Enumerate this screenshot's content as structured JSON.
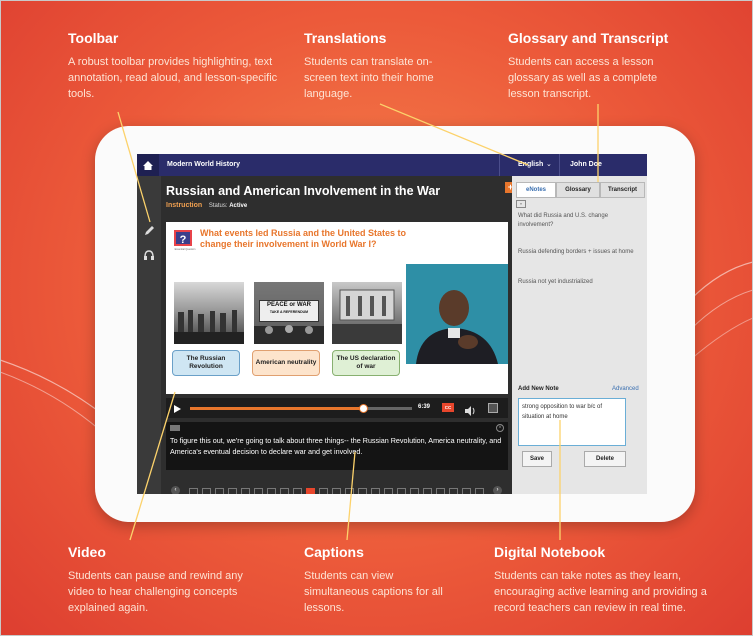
{
  "callouts": {
    "toolbar": {
      "title": "Toolbar",
      "text": "A robust toolbar provides highlighting, text annotation, read aloud, and lesson-specific tools."
    },
    "translations": {
      "title": "Translations",
      "text": "Students can translate on-screen text into their home language."
    },
    "glossary": {
      "title": "Glossary and Transcript",
      "text": "Students can access a lesson glossary as well as a complete lesson transcript."
    },
    "video": {
      "title": "Video",
      "text": "Students can pause and rewind any video to hear challenging concepts explained again."
    },
    "captions": {
      "title": "Captions",
      "text": "Students can view simultaneous captions for all lessons."
    },
    "notebook": {
      "title": "Digital Notebook",
      "text": "Students can take notes as they learn, encouraging active learning and providing a record teachers can review in real time."
    }
  },
  "app": {
    "course_title": "Modern World History",
    "language": "English",
    "user": "John Doe",
    "lesson_title": "Russian and American Involvement in the War",
    "section": "Instruction",
    "status_label": "Status:",
    "status_value": "Active",
    "question": "What events led Russia and the United States to change their involvement in World War I?",
    "question_badge": "Essential Question",
    "images": [
      {
        "sign_line1": "PEACE or WAR",
        "sign_line2": "TAKE A REFERENDUM"
      }
    ],
    "captions": [
      "The Russian Revolution",
      "American neutrality",
      "The US declaration of war"
    ],
    "caption_colors": [
      "#cfe6f3",
      "#fde4cc",
      "#dff0d5"
    ],
    "video_time": "6:39",
    "cc_label": "CC",
    "caption_text": "To figure this out, we're going to talk about three things-- the Russian Revolution, America neutrality, and America's eventual decision to declare war and get involved.",
    "video_progress": 0.78
  },
  "panel": {
    "tabs": [
      "eNotes",
      "Glossary",
      "Transcript"
    ],
    "notes": [
      "What did Russia and U.S. change involvement?",
      "Russia defending borders + issues at home",
      "Russia not yet industrialized"
    ],
    "add_note_label": "Add New Note",
    "advanced_label": "Advanced",
    "note_input": "strong opposition to war b/c of situation at home",
    "save_label": "Save",
    "delete_label": "Delete"
  },
  "colors": {
    "accent_orange": "#e8762c",
    "nav_blue": "#2a2c6a",
    "callout_line": "#fcd26b",
    "background": "#ec5a3a"
  }
}
